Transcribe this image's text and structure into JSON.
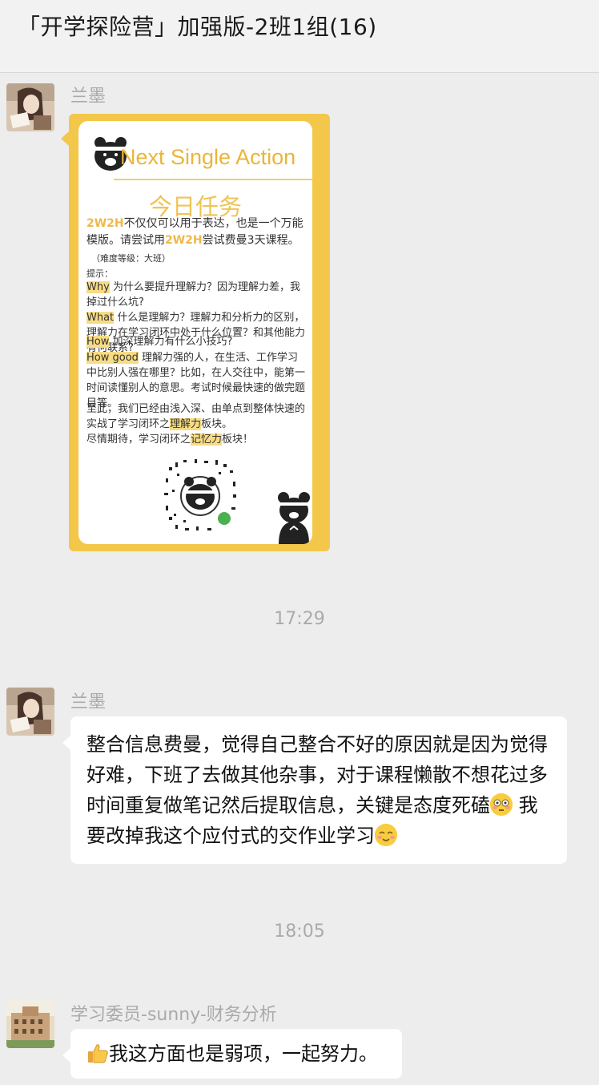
{
  "header": {
    "title": "「开学探险营」加强版-2班1组(16)"
  },
  "messages": [
    {
      "sender": "兰墨"
    },
    {
      "sender": "兰墨",
      "text_a": "整合信息费曼，觉得自己整合不好的原因就是因为觉得好难，下班了去做其他杂事，对于课程懒散不想花过多时间重复做笔记然后提取信息，关键是态度死磕",
      "text_b": "我要改掉我这个应付式的交作业学习"
    },
    {
      "sender": "学习委员-sunny-财务分析",
      "text": "我这方面也是弱项，一起努力。"
    }
  ],
  "timestamps": [
    "17:29",
    "18:05"
  ],
  "card": {
    "title": "Next Single Action",
    "heading": "今日任务",
    "kw_2w2h": "2W2H",
    "intro_a": "不仅仅可以用于表达，也是一个万能模版。请尝试用",
    "intro_b": "尝试费曼3天课程。",
    "level": "（难度等级：大班）",
    "hint": "提示：",
    "why_k": "Why",
    "why_t": "为什么要提升理解力？因为理解力差，我掉过什么坑?",
    "what_k": "What",
    "what_t": "什么是理解力？理解力和分析力的区别，理解力在学习闭环中处于什么位置？和其他能力有何联系?",
    "how_k": "How",
    "how_t": "加深理解力有什么小技巧?",
    "howgood_k": "How good",
    "howgood_t": "理解力强的人，在生活、工作学习中比别人强在哪里？比如，在人交往中，能第一时间读懂别人的意思。考试时候最快速的做完题目等。",
    "closing_a": "至此，我们已经由浅入深、由单点到整体快速的实战了学习闭环之",
    "closing_kw1": "理解力",
    "closing_b": "板块。",
    "closing_c": "尽情期待，学习闭环之",
    "closing_kw2": "记忆力",
    "closing_d": "板块！"
  },
  "icons": {
    "emoji_flushed": "flushed-face-icon",
    "emoji_smile": "smiling-face-icon",
    "emoji_thumbs": "thumbs-up-icon"
  },
  "colors": {
    "background": "#ededed",
    "bubble": "#ffffff",
    "card_frame": "#f3c84a",
    "accent": "#f0c453"
  }
}
